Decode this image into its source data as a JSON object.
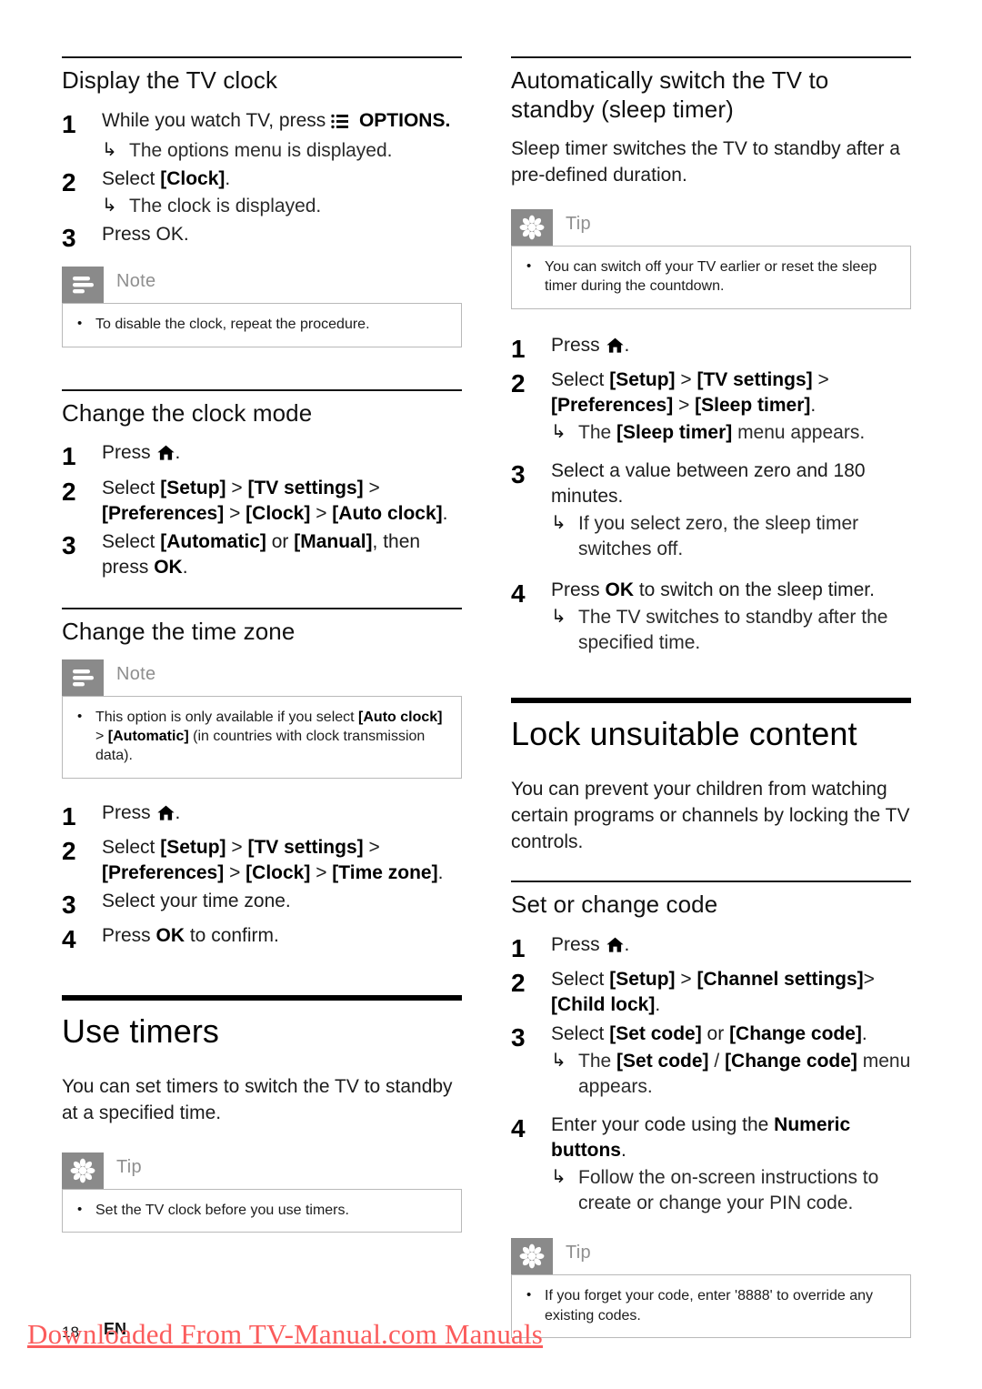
{
  "document": {
    "footer": {
      "page_number": "18",
      "language": "EN",
      "watermark": "Downloaded From TV-Manual.com Manuals",
      "watermark_color": "#fb5c5c"
    }
  },
  "left_column": {
    "section_display_clock": {
      "heading": "Display the TV clock",
      "steps": [
        {
          "num": "1",
          "text_before_icon": "While you watch TV, press ",
          "icon": "options-icon",
          "text_after_icon": " OPTIONS.",
          "result": "The options menu is displayed."
        },
        {
          "num": "2",
          "text": "Select [Clock].",
          "bold_part": "[Clock]",
          "result": "The clock is displayed."
        },
        {
          "num": "3",
          "text": "Press OK.",
          "bold_part": "OK"
        }
      ],
      "note": {
        "label": "Note",
        "icon": "note-icon",
        "items": [
          "To disable the clock, repeat the procedure."
        ]
      }
    },
    "section_clock_mode": {
      "heading": "Change the clock mode",
      "steps": [
        {
          "num": "1",
          "text_before_icon": "Press ",
          "icon": "home-icon",
          "text_after_icon": "."
        },
        {
          "num": "2",
          "text": "Select [Setup] > [TV settings] > [Preferences] > [Clock] > [Auto clock]."
        },
        {
          "num": "3",
          "text": "Select [Automatic] or [Manual], then press OK."
        }
      ]
    },
    "section_time_zone": {
      "heading": "Change the time zone",
      "note": {
        "label": "Note",
        "icon": "note-icon",
        "items": [
          "This option is only available if you select [Auto clock] > [Automatic] (in countries with clock transmission data)."
        ]
      },
      "steps": [
        {
          "num": "1",
          "text_before_icon": "Press ",
          "icon": "home-icon",
          "text_after_icon": "."
        },
        {
          "num": "2",
          "text": "Select [Setup] > [TV settings] > [Preferences] > [Clock] > [Time zone]."
        },
        {
          "num": "3",
          "text": "Select your time zone."
        },
        {
          "num": "4",
          "text": "Press OK to confirm."
        }
      ]
    },
    "section_use_timers": {
      "heading": "Use timers",
      "intro": "You can set timers to switch the TV to standby at a specified time.",
      "tip": {
        "label": "Tip",
        "icon": "tip-icon",
        "items": [
          "Set the TV clock before you use timers."
        ]
      }
    }
  },
  "right_column": {
    "section_sleep_timer": {
      "heading": "Automatically switch the TV to standby (sleep timer)",
      "intro": "Sleep timer switches the TV to standby after a pre-defined duration.",
      "tip": {
        "label": "Tip",
        "icon": "tip-icon",
        "items": [
          "You can switch off your TV earlier or reset the sleep timer during the countdown."
        ]
      },
      "steps": [
        {
          "num": "1",
          "text_before_icon": "Press ",
          "icon": "home-icon",
          "text_after_icon": "."
        },
        {
          "num": "2",
          "text": "Select [Setup] > [TV settings] > [Preferences] > [Sleep timer].",
          "result": "The [Sleep timer] menu appears."
        },
        {
          "num": "3",
          "text": "Select a value between zero and 180 minutes.",
          "result": "If you select zero, the sleep timer switches off."
        },
        {
          "num": "4",
          "text": "Press OK to switch on the sleep timer.",
          "result": "The TV switches to standby after the specified time."
        }
      ]
    },
    "section_lock_content": {
      "heading": "Lock unsuitable content",
      "intro": "You can prevent your children from watching certain programs or channels by locking the TV controls."
    },
    "section_set_change_code": {
      "heading": "Set or change code",
      "steps": [
        {
          "num": "1",
          "text_before_icon": "Press ",
          "icon": "home-icon",
          "text_after_icon": "."
        },
        {
          "num": "2",
          "text": "Select [Setup] > [Channel settings]>[Child lock]."
        },
        {
          "num": "3",
          "text": "Select [Set code] or [Change code].",
          "result": "The [Set code] / [Change code] menu appears."
        },
        {
          "num": "4",
          "text": "Enter your code using the Numeric buttons.",
          "result": "Follow the on-screen instructions to create or change your PIN code."
        }
      ],
      "tip": {
        "label": "Tip",
        "icon": "tip-icon",
        "items": [
          "If you forget your code, enter '8888' to override any existing codes."
        ]
      }
    }
  }
}
